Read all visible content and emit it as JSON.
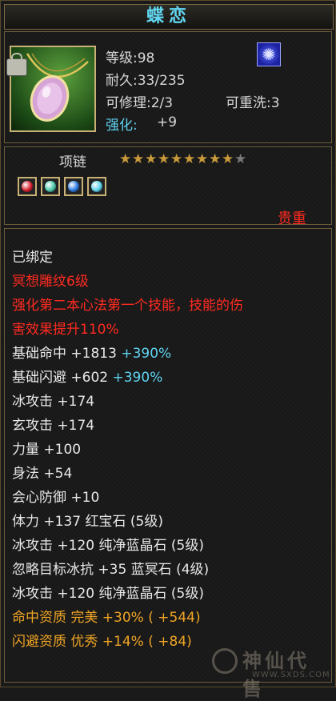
{
  "item": {
    "name": "蝶恋",
    "level": "等级:98",
    "durability": "耐久:33/235",
    "repair": "可修理:2/3",
    "rewash": "可重洗:3",
    "enhance_label": "强化:",
    "enhance_value": "+9",
    "type": "项链",
    "stars_filled": 9,
    "stars_total": 10,
    "rarity": "贵重"
  },
  "gems": [
    {
      "name": "red-gem-icon",
      "color": "#d81c2c"
    },
    {
      "name": "green-gem-icon",
      "color": "#48c6a8"
    },
    {
      "name": "blue-gem-icon",
      "color": "#2a78e0"
    },
    {
      "name": "cyan-gem-icon",
      "color": "#58d0e8"
    }
  ],
  "lines": [
    {
      "parts": [
        {
          "t": "已绑定",
          "c": "white"
        }
      ]
    },
    {
      "parts": [
        {
          "t": "冥想雕纹6级",
          "c": "red"
        }
      ]
    },
    {
      "parts": [
        {
          "t": "强化第二本心法第一个技能，技能的伤",
          "c": "red"
        }
      ]
    },
    {
      "parts": [
        {
          "t": "害效果提升110%",
          "c": "red"
        }
      ]
    },
    {
      "parts": [
        {
          "t": "基础命中 +1813 ",
          "c": "white"
        },
        {
          "t": "+390%",
          "c": "cyanv"
        }
      ]
    },
    {
      "parts": [
        {
          "t": "基础闪避 +602 ",
          "c": "white"
        },
        {
          "t": "+390%",
          "c": "cyanv"
        }
      ]
    },
    {
      "parts": [
        {
          "t": "冰攻击 +174",
          "c": "white"
        }
      ]
    },
    {
      "parts": [
        {
          "t": "玄攻击 +174",
          "c": "white"
        }
      ]
    },
    {
      "parts": [
        {
          "t": "力量 +100",
          "c": "white"
        }
      ]
    },
    {
      "parts": [
        {
          "t": "身法 +54",
          "c": "white"
        }
      ]
    },
    {
      "parts": [
        {
          "t": "会心防御 +10",
          "c": "white"
        }
      ]
    },
    {
      "parts": [
        {
          "t": "体力 +137 红宝石 (5级)",
          "c": "white"
        }
      ]
    },
    {
      "parts": [
        {
          "t": "冰攻击 +120 纯净蓝晶石 (5级)",
          "c": "white"
        }
      ]
    },
    {
      "parts": [
        {
          "t": "忽略目标冰抗 +35 蓝冥石 (4级)",
          "c": "white"
        }
      ]
    },
    {
      "parts": [
        {
          "t": "冰攻击 +120 纯净蓝晶石 (5级)",
          "c": "white"
        }
      ]
    },
    {
      "parts": [
        {
          "t": "命中资质  完美 +30% ( +544)",
          "c": "orange"
        }
      ]
    },
    {
      "parts": [
        {
          "t": "闪避资质  优秀 +14% ( +84)",
          "c": "orange"
        }
      ]
    }
  ],
  "watermark": {
    "main": "神仙代售",
    "sub": "WWW.SXDS.COM"
  }
}
